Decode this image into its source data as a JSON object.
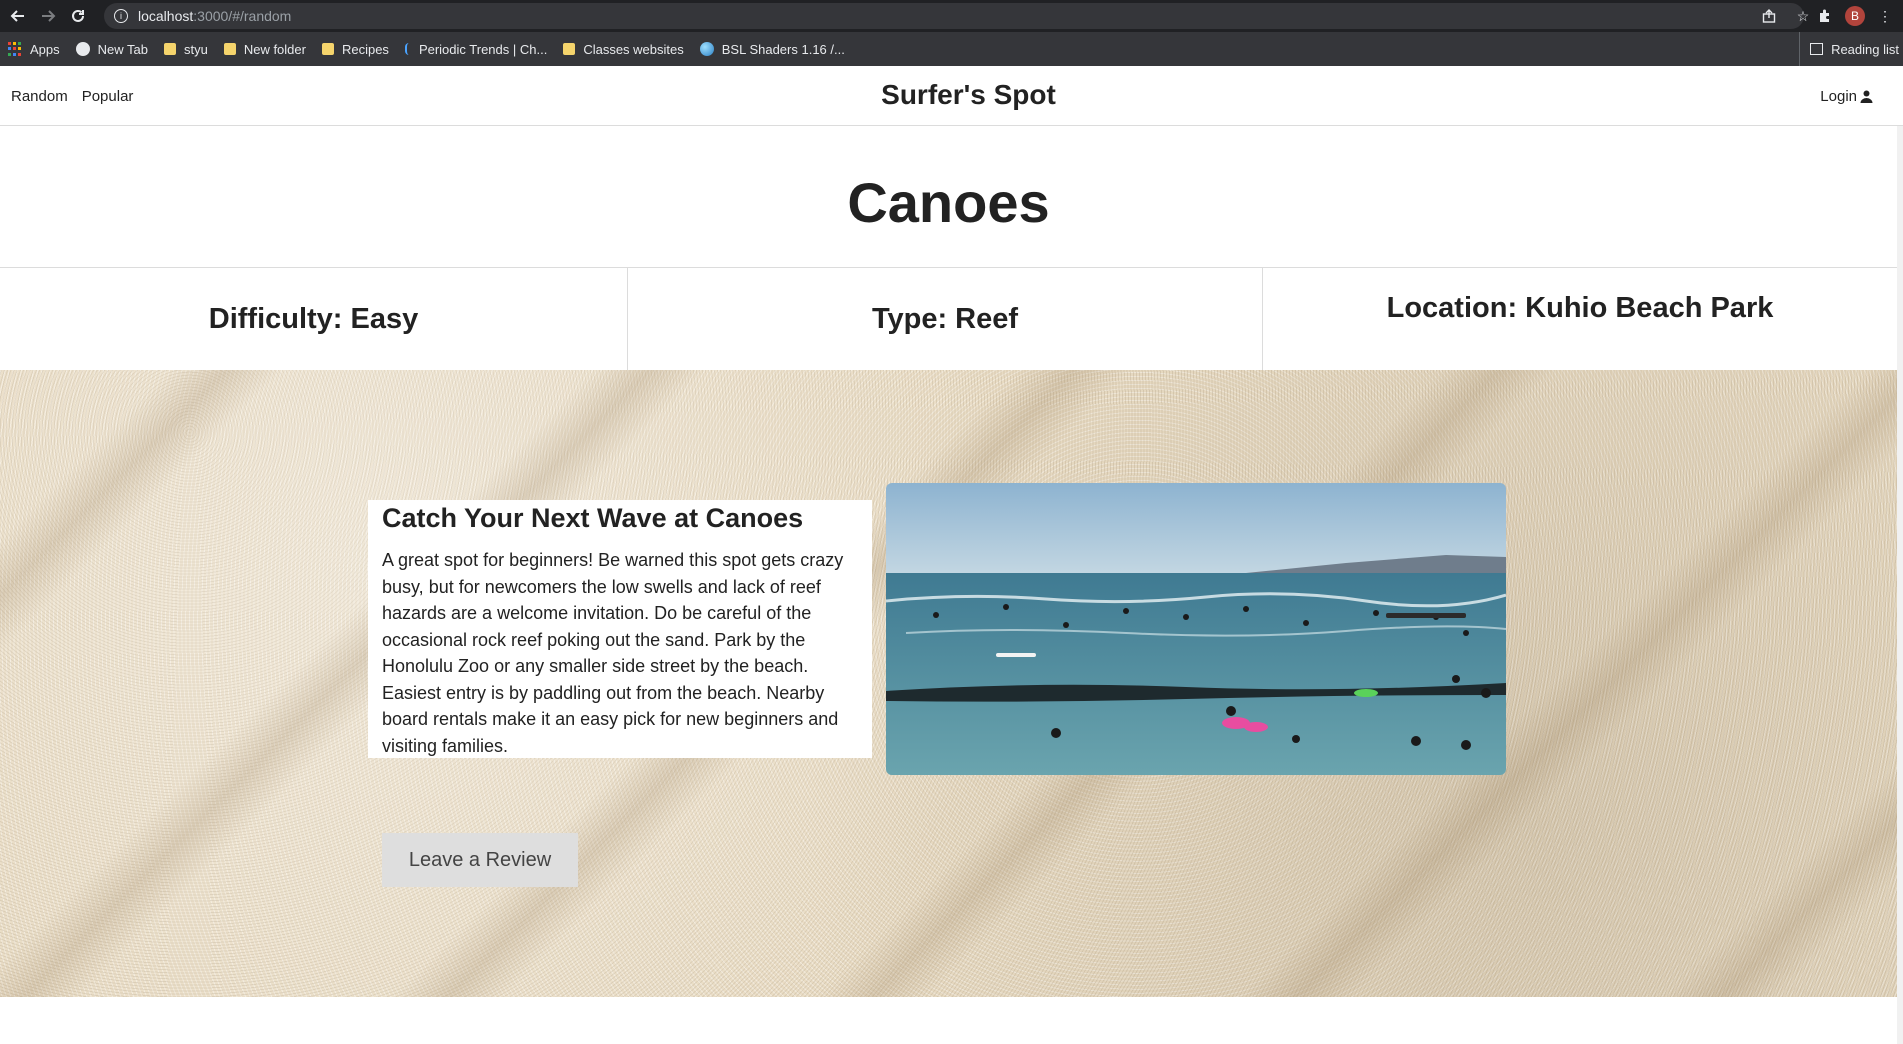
{
  "browser": {
    "url_host": "localhost",
    "url_path": ":3000/#/random",
    "avatar_letter": "B",
    "bookmarks": [
      {
        "label": "Apps",
        "icon": "apps-grid-icon"
      },
      {
        "label": "New Tab",
        "icon": "globe-icon"
      },
      {
        "label": "styu",
        "icon": "folder-icon"
      },
      {
        "label": "New folder",
        "icon": "folder-icon"
      },
      {
        "label": "Recipes",
        "icon": "folder-icon"
      },
      {
        "label": "Periodic Trends | Ch...",
        "icon": "bookmark-page-icon"
      },
      {
        "label": "Classes websites",
        "icon": "folder-icon"
      },
      {
        "label": "BSL Shaders 1.16 /...",
        "icon": "bsl-globe-icon"
      }
    ],
    "reading_list": "Reading list"
  },
  "site": {
    "nav": {
      "random": "Random",
      "popular": "Popular"
    },
    "title": "Surfer's Spot",
    "login": "Login"
  },
  "spot": {
    "name": "Canoes",
    "difficulty": "Difficulty: Easy",
    "type": "Type: Reef",
    "location": "Location: Kuhio Beach Park",
    "card_title": "Catch Your Next Wave at Canoes",
    "description": "A great spot for beginners! Be warned this spot gets crazy busy, but for newcomers the low swells and lack of reef hazards are a welcome invitation. Do be careful of the occasional rock reef poking out the sand. Park by the Honolulu Zoo or any smaller side street by the beach. Easiest entry is by paddling out from the beach. Nearby board rentals make it an easy pick for new beginners and visiting families.",
    "review_button": "Leave a Review"
  },
  "colors": {
    "chrome_dark": "#202124",
    "bookmarks_bar": "#35363a",
    "sand": "#e9dcc4",
    "ocean": "#4f8a9c",
    "button_bg": "#dedede"
  }
}
